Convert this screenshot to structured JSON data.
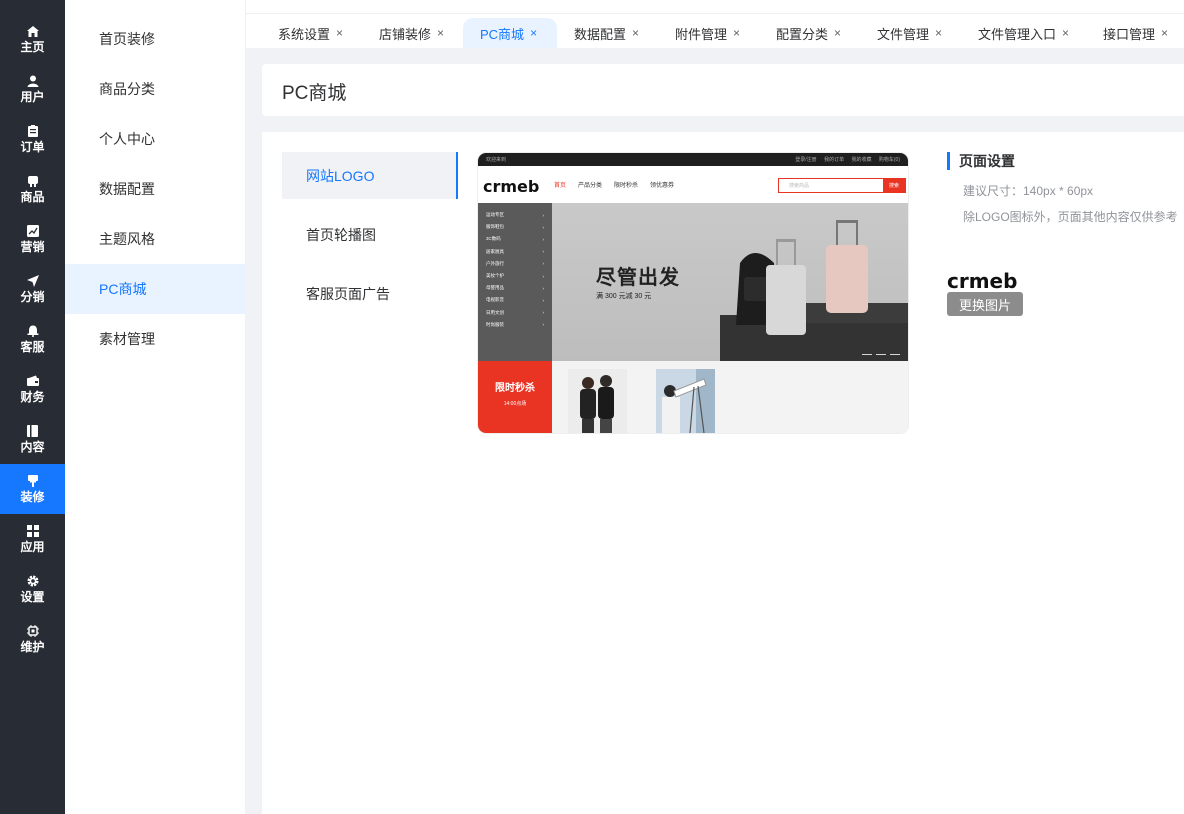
{
  "rail": {
    "items": [
      {
        "label": "主页",
        "icon": "home-icon"
      },
      {
        "label": "用户",
        "icon": "user-icon"
      },
      {
        "label": "订单",
        "icon": "order-icon"
      },
      {
        "label": "商品",
        "icon": "product-icon"
      },
      {
        "label": "营销",
        "icon": "marketing-icon"
      },
      {
        "label": "分销",
        "icon": "distribution-icon"
      },
      {
        "label": "客服",
        "icon": "service-icon"
      },
      {
        "label": "财务",
        "icon": "finance-icon"
      },
      {
        "label": "内容",
        "icon": "content-icon"
      },
      {
        "label": "装修",
        "icon": "decoration-icon",
        "active": true
      },
      {
        "label": "应用",
        "icon": "apps-icon"
      },
      {
        "label": "设置",
        "icon": "settings-icon"
      },
      {
        "label": "维护",
        "icon": "maintenance-icon"
      }
    ]
  },
  "submenu": {
    "items": [
      {
        "label": "首页装修"
      },
      {
        "label": "商品分类"
      },
      {
        "label": "个人中心"
      },
      {
        "label": "数据配置"
      },
      {
        "label": "主题风格"
      },
      {
        "label": "PC商城",
        "active": true
      },
      {
        "label": "素材管理"
      }
    ]
  },
  "tabs": {
    "items": [
      {
        "label": "系统设置",
        "close": "×"
      },
      {
        "label": "店铺装修",
        "close": "×"
      },
      {
        "label": "PC商城",
        "close": "×",
        "active": true
      },
      {
        "label": "数据配置",
        "close": "×"
      },
      {
        "label": "附件管理",
        "close": "×"
      },
      {
        "label": "配置分类",
        "close": "×"
      },
      {
        "label": "文件管理",
        "close": "×"
      },
      {
        "label": "文件管理入口",
        "close": "×"
      },
      {
        "label": "接口管理",
        "close": "×"
      }
    ]
  },
  "page": {
    "title": "PC商城"
  },
  "section_tabs": [
    {
      "label": "网站LOGO",
      "active": true
    },
    {
      "label": "首页轮播图"
    },
    {
      "label": "客服页面广告"
    }
  ],
  "preview": {
    "topbar_left": "欢迎来到",
    "topbar_links": [
      "登录/注册",
      "我的订单",
      "我的收藏",
      "购物车(0)"
    ],
    "logo_text": "crmeb",
    "menu": [
      "首页",
      "产品分类",
      "限时秒杀",
      "领优惠券"
    ],
    "search_placeholder": "搜索商品",
    "search_button": "搜索",
    "categories": [
      "运动专区",
      "服饰鞋包",
      "3C数码",
      "居家厨具",
      "户外旅行",
      "美妆个护",
      "母婴用品",
      "电视影音",
      "日用文创",
      "时尚服装"
    ],
    "banner_title": "尽管出发",
    "banner_sub": "满 300 元减 30 元",
    "flash_title": "限时秒杀",
    "flash_time": "14:00点场",
    "accent": "#e93323"
  },
  "settings": {
    "title": "页面设置",
    "size_hint": "建议尺寸：140px * 60px",
    "note": "除LOGO图标外，页面其他内容仅供参考",
    "logo_text": "crmeb",
    "change_button": "更换图片"
  },
  "colors": {
    "primary": "#1677ff",
    "rail_bg": "#282c34"
  }
}
